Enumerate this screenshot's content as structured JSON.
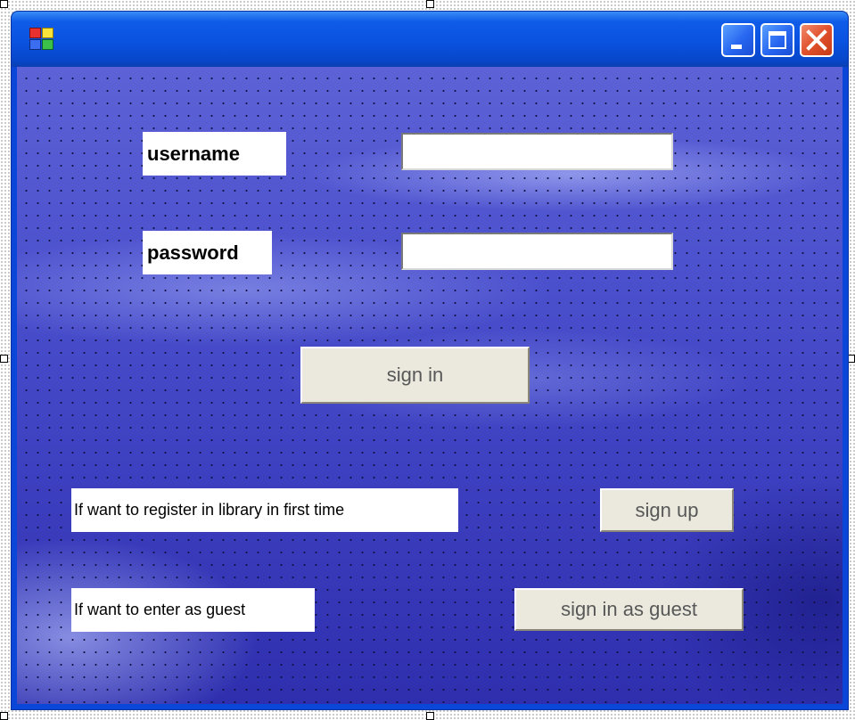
{
  "window": {
    "title": "",
    "controls": {
      "minimize_icon": "minimize-icon",
      "maximize_icon": "maximize-icon",
      "close_icon": "close-icon"
    }
  },
  "form": {
    "username_label": "username",
    "password_label": "password",
    "username_value": "",
    "password_value": "",
    "sign_in_button": "sign in",
    "register_prompt": "If want to register in library in first time",
    "sign_up_button": "sign up",
    "guest_prompt": "If want to enter as guest",
    "guest_button": "sign in as guest"
  },
  "colors": {
    "titlebar": "#0a52e0",
    "client_background": "#4a4fcc",
    "button_face": "#ebe9de",
    "button_text": "#585858",
    "close_button": "#e0502c"
  }
}
